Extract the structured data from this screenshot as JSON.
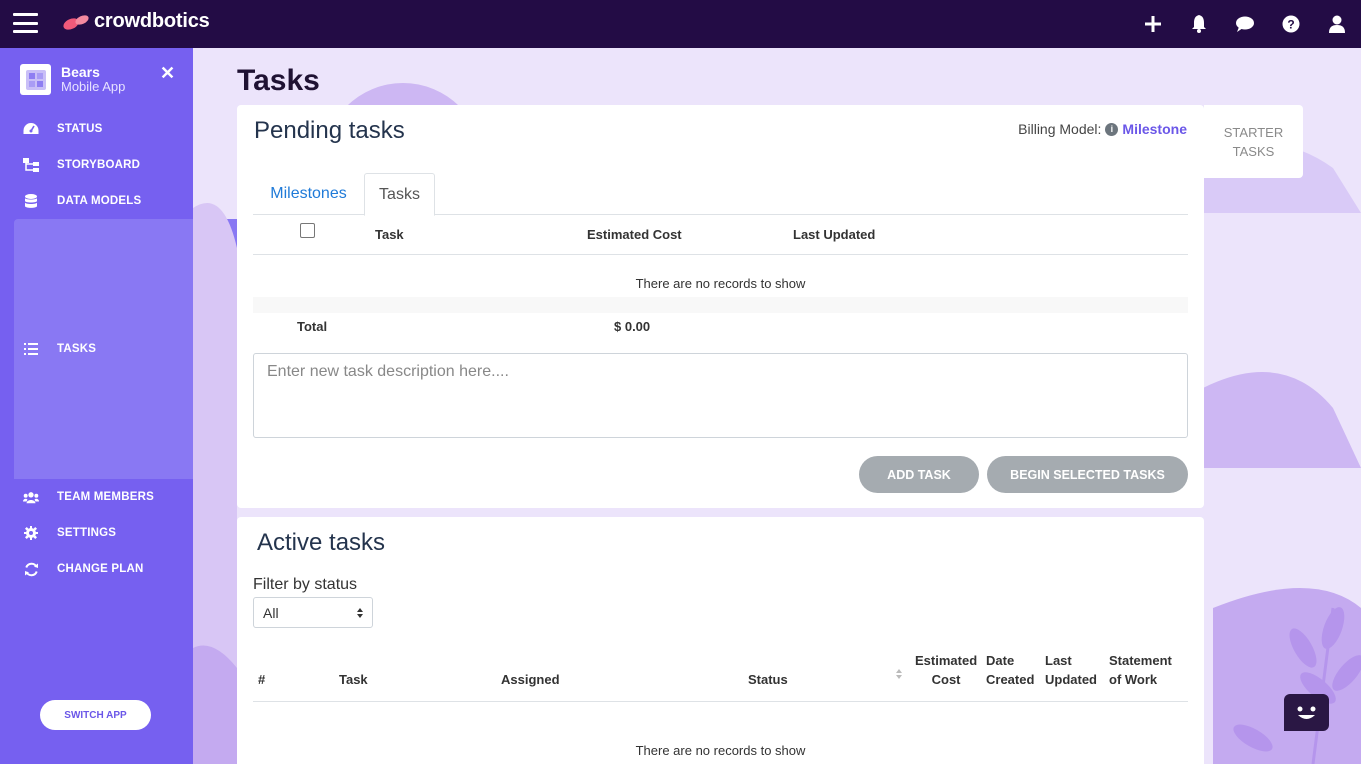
{
  "topbar": {
    "brand": "crowdbotics",
    "icons": [
      "plus-icon",
      "bell-icon",
      "chat-icon",
      "help-icon",
      "user-icon"
    ]
  },
  "sidebar": {
    "app_name": "Bears",
    "app_type": "Mobile App",
    "items": [
      {
        "label": "STATUS",
        "icon": "dashboard-icon"
      },
      {
        "label": "STORYBOARD",
        "icon": "sitemap-icon"
      },
      {
        "label": "DATA MODELS",
        "icon": "database-icon"
      },
      {
        "label": "TASKS",
        "icon": "tasks-icon",
        "active": true
      },
      {
        "label": "TEAM MEMBERS",
        "icon": "users-icon"
      },
      {
        "label": "SETTINGS",
        "icon": "gear-icon"
      },
      {
        "label": "CHANGE PLAN",
        "icon": "sync-icon"
      }
    ],
    "switch_app": "SWITCH APP"
  },
  "page": {
    "title": "Tasks"
  },
  "pending": {
    "title": "Pending tasks",
    "billing_label": "Billing Model:",
    "billing_value": "Milestone",
    "starter_tab": "STARTER TASKS",
    "tabs": [
      {
        "label": "Milestones",
        "active": false
      },
      {
        "label": "Tasks",
        "active": true
      }
    ],
    "columns": [
      "Task",
      "Estimated Cost",
      "Last Updated"
    ],
    "empty": "There are no records to show",
    "total_label": "Total",
    "total_value": "$ 0.00",
    "input_placeholder": "Enter new task description here....",
    "add_button": "ADD TASK",
    "begin_button": "BEGIN SELECTED TASKS"
  },
  "active": {
    "title": "Active tasks",
    "filter_label": "Filter by status",
    "filter_value": "All",
    "columns": {
      "num": "#",
      "task": "Task",
      "assigned": "Assigned",
      "status": "Status",
      "est1": "Estimated",
      "est2": "Cost",
      "date1": "Date",
      "date2": "Created",
      "upd1": "Last",
      "upd2": "Updated",
      "sow1": "Statement",
      "sow2": "of Work"
    },
    "empty": "There are no records to show"
  },
  "colors": {
    "topbar": "#230c45",
    "sidebar": "#7660f0",
    "accent": "#6b57e8",
    "link": "#1f7ad8",
    "button_disabled": "#a5abb0"
  }
}
